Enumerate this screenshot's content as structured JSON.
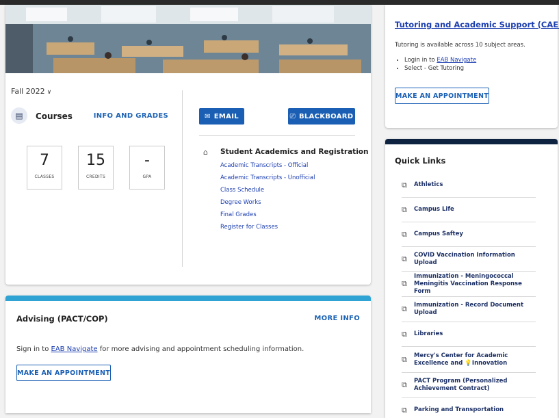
{
  "main": {
    "term": "Fall 2022",
    "courses": {
      "title": "Courses",
      "link": "INFO AND GRADES"
    },
    "stats": [
      {
        "value": "7",
        "label": "CLASSES"
      },
      {
        "value": "15",
        "label": "CREDITS"
      },
      {
        "value": "-",
        "label": "GPA"
      }
    ],
    "buttons": {
      "email": "EMAIL",
      "blackboard": "BLACKBOARD"
    },
    "academics": {
      "title": "Student Academics and Registration",
      "links": [
        "Academic Transcripts - Official",
        "Academic Transcripts - Unofficial",
        "Class Schedule",
        "Degree Works",
        "Final Grades",
        "Register for Classes"
      ]
    }
  },
  "advising": {
    "title": "Advising (PACT/COP)",
    "more_info": "MORE INFO",
    "text_before": "Sign in to ",
    "link": "EAB Navigate",
    "text_after": " for more advising and appointment scheduling information.",
    "button": "MAKE AN APPOINTMENT"
  },
  "tutoring": {
    "title": "Tutoring and Academic Support (CAEI)",
    "description": "Tutoring is available across 10 subject areas.",
    "step1_before": "Login in to ",
    "step1_link": "EAB Navigate",
    "step2": "Select - Get Tutoring",
    "button": "MAKE AN APPOINTMENT"
  },
  "quick_links": {
    "title": "Quick Links",
    "items": [
      "Athletics",
      "Campus Life",
      "Campus Saftey",
      "COVID Vaccination Information Upload",
      "Immunization - Meningococcal Meningitis Vaccination Response Form",
      "Immunization - Record Document Upload",
      "Libraries",
      "Mercy's Center for Academic Excellence and 💡Innovation",
      "PACT Program (Personalized Achievement Contract)",
      "Parking and Transportation"
    ]
  },
  "colors": {
    "primary": "#1a5fb4",
    "advising_strip": "#2ea3d4",
    "quicklinks_strip": "#0d2340"
  }
}
